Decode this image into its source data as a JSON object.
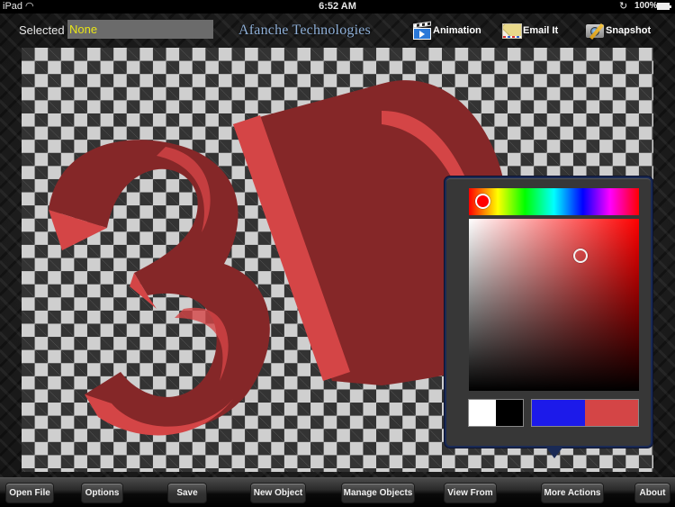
{
  "status_bar": {
    "device": "iPad",
    "time": "6:52 AM",
    "battery": "100%"
  },
  "toolbar": {
    "selected_label": "Selected",
    "selected_value": "None",
    "brand": "Afanche Technologies",
    "animation_label": "Animation",
    "email_label": "Email It",
    "snapshot_label": "Snapshot"
  },
  "canvas": {
    "model_text": "3D",
    "model_color": "#d44546",
    "model_shadow_color": "#862728"
  },
  "color_picker": {
    "hue_color": "#ff0000",
    "selected_color": "#d44546",
    "swatches": [
      {
        "name": "white",
        "color": "#ffffff"
      },
      {
        "name": "black",
        "color": "#000000"
      },
      {
        "name": "previous",
        "color": "#1c1aea"
      },
      {
        "name": "current",
        "color": "#d44546"
      }
    ]
  },
  "bottom_bar": {
    "buttons": [
      {
        "label": "Open File"
      },
      {
        "label": "Options"
      },
      {
        "label": "Save"
      },
      {
        "label": "New Object"
      },
      {
        "label": "Manage Objects"
      },
      {
        "label": "View From"
      },
      {
        "label": "More Actions"
      },
      {
        "label": "About"
      }
    ]
  }
}
